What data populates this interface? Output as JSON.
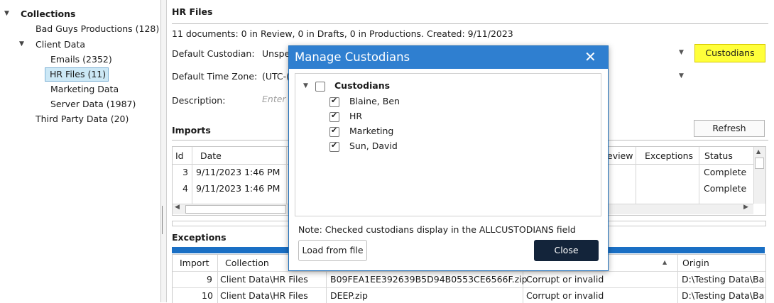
{
  "tree": {
    "root_label": "Collections",
    "items": [
      {
        "label": "Bad Guys Productions (128)"
      },
      {
        "label": "Client Data"
      },
      {
        "label": "Emails (2352)"
      },
      {
        "label": "HR Files (11)"
      },
      {
        "label": "Marketing Data"
      },
      {
        "label": "Server Data (1987)"
      },
      {
        "label": "Third Party Data (20)"
      }
    ]
  },
  "main": {
    "title": "HR Files",
    "summary": "11 documents: 0 in Review, 0 in Drafts, 0 in Productions. Created: 9/11/2023",
    "default_custodian_label": "Default Custodian:",
    "default_custodian_value": "Unspe",
    "custodians_button": "Custodians",
    "default_timezone_label": "Default Time Zone:",
    "default_timezone_value": "(UTC-(",
    "description_label": "Description:",
    "description_placeholder": "Enter",
    "imports_title": "Imports",
    "refresh_button": "Refresh",
    "imports_columns": {
      "id": "Id",
      "date": "Date",
      "review": "eview",
      "exceptions": "Exceptions",
      "status": "Status"
    },
    "imports_rows": [
      {
        "id": "3",
        "date": "9/11/2023 1:46 PM",
        "status": "Complete"
      },
      {
        "id": "4",
        "date": "9/11/2023 1:46 PM",
        "status": "Complete"
      }
    ],
    "exceptions_title": "Exceptions",
    "exceptions_columns": {
      "import": "Import",
      "collection": "Collection",
      "origin": "Origin"
    },
    "exceptions_rows": [
      {
        "import": "9",
        "collection": "Client Data\\HR Files",
        "file": "B09FEA1EE392639B5D94B0553CE6566F.zip",
        "reason": "Corrupt or invalid",
        "origin": "D:\\Testing Data\\Ba"
      },
      {
        "import": "10",
        "collection": "Client Data\\HR Files",
        "file": "DEEP.zip",
        "reason": "Corrupt or invalid",
        "origin": "D:\\Testing Data\\Ba"
      }
    ]
  },
  "modal": {
    "title": "Manage Custodians",
    "close_glyph": "✕",
    "root_label": "Custodians",
    "custodians": [
      {
        "label": "Blaine, Ben",
        "checked": true
      },
      {
        "label": "HR",
        "checked": true
      },
      {
        "label": "Marketing",
        "checked": true
      },
      {
        "label": "Sun, David",
        "checked": true
      }
    ],
    "note": "Note: Checked custodians display in the ALLCUSTODIANS field",
    "load_button": "Load from file",
    "close_button": "Close"
  },
  "colors": {
    "accent": "#2f7fd0",
    "highlight": "#ffff3a",
    "dark_button": "#13243a",
    "progress": "#1a6fc4"
  },
  "icons": [
    "expand-triangle-icon",
    "dropdown-arrow-icon",
    "close-icon",
    "checkbox-icon",
    "sort-up-icon",
    "scroll-arrow-icon"
  ]
}
